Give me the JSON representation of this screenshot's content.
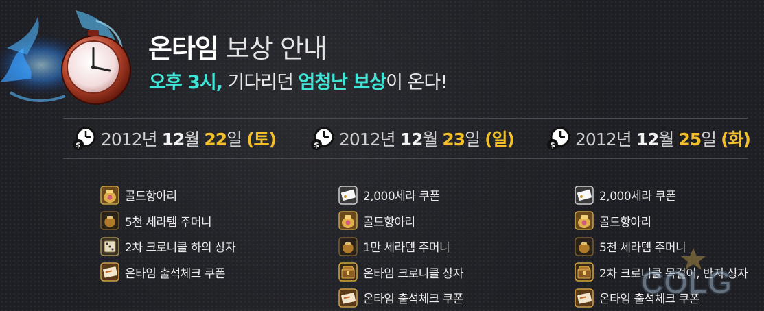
{
  "header": {
    "title_bold": "온타임",
    "title_rest": " 보상 안내",
    "subtitle_time": "오후 3시,",
    "subtitle_mid": " 기다리던 ",
    "subtitle_emph": "엄청난 보상",
    "subtitle_end": "이 온다!"
  },
  "colors": {
    "accent_cyan": "#3fe6d8",
    "accent_yellow": "#f3c02a",
    "divider": "#4a4b52"
  },
  "columns": [
    {
      "date": {
        "year": "2012",
        "year_unit": "년 ",
        "month": "12",
        "month_unit": "월 ",
        "day": "22",
        "day_unit": "일 ",
        "weekday": "(토)"
      },
      "items": [
        {
          "label": "골드항아리",
          "icon": "gold-pot-icon"
        },
        {
          "label": "5천 세라템 주머니",
          "icon": "pouch-icon"
        },
        {
          "label": "2차 크로니클 하의 상자",
          "icon": "dice-box-icon"
        },
        {
          "label": "온타임 출석체크 쿠폰",
          "icon": "coupon-icon"
        }
      ]
    },
    {
      "date": {
        "year": "2012",
        "year_unit": "년 ",
        "month": "12",
        "month_unit": "월 ",
        "day": "23",
        "day_unit": "일 ",
        "weekday": "(일)"
      },
      "items": [
        {
          "label": "2,000세라 쿠폰",
          "icon": "cera-coupon-icon"
        },
        {
          "label": "골드항아리",
          "icon": "gold-pot-icon"
        },
        {
          "label": "1만 세라템 주머니",
          "icon": "pouch-icon"
        },
        {
          "label": "온타임 크로니클 상자",
          "icon": "chest-icon"
        },
        {
          "label": "온타임 출석체크 쿠폰",
          "icon": "coupon-icon"
        }
      ]
    },
    {
      "date": {
        "year": "2012",
        "year_unit": "년 ",
        "month": "12",
        "month_unit": "월 ",
        "day": "25",
        "day_unit": "일 ",
        "weekday": "(화)"
      },
      "items": [
        {
          "label": "2,000세라 쿠폰",
          "icon": "cera-coupon-icon"
        },
        {
          "label": "골드항아리",
          "icon": "gold-pot-icon"
        },
        {
          "label": "5천 세라템 주머니",
          "icon": "pouch-icon"
        },
        {
          "label": "2차 크로니클 목걸이, 반지 상자",
          "icon": "chest-icon"
        },
        {
          "label": "온타임 출석체크 쿠폰",
          "icon": "coupon-icon"
        }
      ]
    }
  ],
  "watermark": {
    "text": "COLG"
  }
}
